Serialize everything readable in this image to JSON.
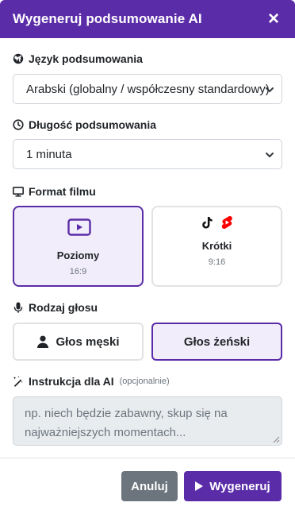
{
  "modal": {
    "title": "Wygeneruj podsumowanie AI",
    "close_label": "×",
    "accent": "#5b2ca8"
  },
  "language": {
    "label": "Język podsumowania",
    "icon": "globe-icon",
    "selected": "Arabski (globalny / współczesny standardowy)"
  },
  "length": {
    "label": "Długość podsumowania",
    "icon": "clock-icon",
    "selected": "1 minuta"
  },
  "format": {
    "label": "Format filmu",
    "icon": "monitor-icon",
    "options": [
      {
        "title": "Poziomy",
        "ratio": "16:9",
        "icon": "video-play-icon",
        "selected": true
      },
      {
        "title": "Krótki",
        "ratio": "9:16",
        "icon": "tiktok-youtube-shorts-icon",
        "selected": false
      }
    ]
  },
  "voice": {
    "label": "Rodzaj głosu",
    "icon": "microphone-icon",
    "options": [
      {
        "label": "Głos męski",
        "icon": "user-icon",
        "selected": false
      },
      {
        "label": "Głos żeński",
        "selected": true
      }
    ]
  },
  "instructions": {
    "label": "Instrukcja dla AI",
    "optional": "(opcjonalnie)",
    "icon": "magic-wand-icon",
    "placeholder": "np. niech będzie zabawny, skup się na najważniejszych momentach..."
  },
  "footer": {
    "cancel_label": "Anuluj",
    "generate_label": "Wygeneruj"
  }
}
